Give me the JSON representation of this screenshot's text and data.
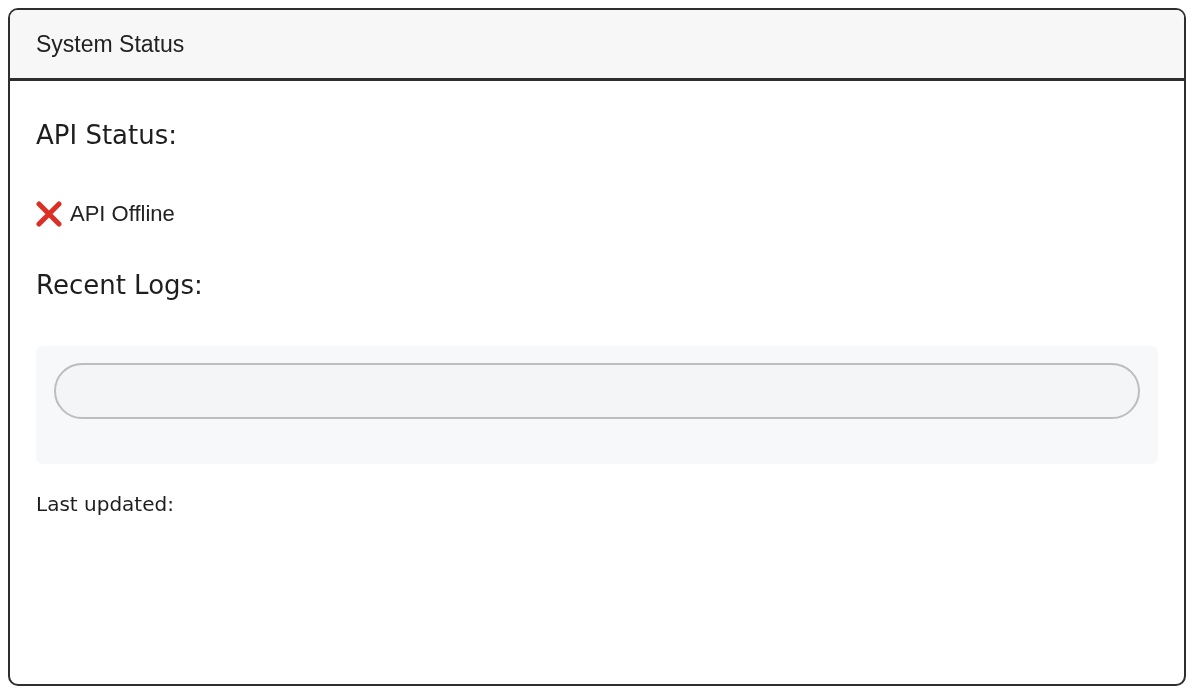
{
  "window": {
    "title": "System Status"
  },
  "api_status": {
    "heading": "API Status:",
    "online": false,
    "label": "API Offline"
  },
  "logs": {
    "heading": "Recent Logs:"
  },
  "footer": {
    "last_updated_label": "Last updated:"
  }
}
